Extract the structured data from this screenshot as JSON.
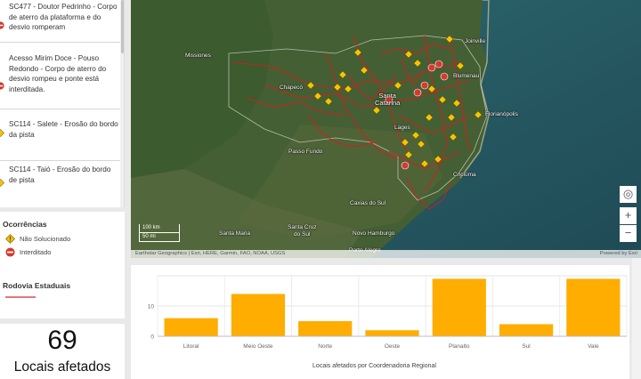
{
  "list": {
    "items": [
      {
        "text": "SC477 - Doutor Pedrinho - Corpo de aterro da plataforma e do desvio romperam",
        "status": "interditado"
      },
      {
        "text": "Acesso Mirim Doce - Pouso Redondo - Corpo de aterro do desvio rompeu e ponte está interditada.",
        "status": "interditado"
      },
      {
        "text": "SC114 - Salete - Erosão do bordo da pista",
        "status": "nao_solucionado"
      },
      {
        "text": "SC114 - Taió - Erosão do bordo de pista",
        "status": "nao_solucionado"
      }
    ]
  },
  "legend": {
    "title": "Ocorrências",
    "items": [
      {
        "label": "Não Solucionado",
        "icon": "warning-diamond-icon",
        "color": "#f5c400"
      },
      {
        "label": "Interditado",
        "icon": "no-entry-icon",
        "color": "#d63a2f"
      }
    ],
    "roads_title": "Rodovia Estaduais",
    "roads_color": "#e0787a"
  },
  "summary": {
    "value": "69",
    "label": "Locais afetados"
  },
  "map": {
    "places": [
      {
        "name": "Missiones",
        "big": false
      },
      {
        "name": "Joinville",
        "big": false
      },
      {
        "name": "Blumenau",
        "big": false
      },
      {
        "name": "Chapecó",
        "big": false
      },
      {
        "name": "Santa\nCatarina",
        "big": true
      },
      {
        "name": "Florianópolis",
        "big": false
      },
      {
        "name": "Lages",
        "big": false
      },
      {
        "name": "Passo Fundo",
        "big": false
      },
      {
        "name": "Criciúma",
        "big": false
      },
      {
        "name": "Caxias do Sul",
        "big": false
      },
      {
        "name": "Santa Maria",
        "big": false
      },
      {
        "name": "Santa Cruz\ndo Sul",
        "big": false
      },
      {
        "name": "Novo Hamburgo",
        "big": false
      },
      {
        "name": "Porto Alegre",
        "big": false
      }
    ],
    "scale_km": "100 km",
    "scale_mi": "50 mi",
    "attribution": "Earthstar Geographics | Esri, HERE, Garmin, FAO, NOAA, USGS",
    "powered_by": "Powered by Esri",
    "buttons": [
      {
        "name": "locate-button",
        "icon": "crosshair-icon",
        "glyph": "◎"
      },
      {
        "name": "zoom-in-button",
        "icon": "plus-icon",
        "glyph": "+"
      },
      {
        "name": "zoom-out-button",
        "icon": "minus-icon",
        "glyph": "−"
      }
    ]
  },
  "chart_data": {
    "type": "bar",
    "categories": [
      "Litoral",
      "Meio Oeste",
      "Norte",
      "Oeste",
      "Planalto",
      "Sul",
      "Vale"
    ],
    "values": [
      6,
      14,
      5,
      2,
      19,
      4,
      19
    ],
    "xlabel": "Locais afetados por Coordenadoria Regional",
    "ylabel": "",
    "ylim": [
      0,
      20
    ],
    "yticks": [
      0,
      10
    ],
    "bar_color": "#ffad00",
    "grid": true
  }
}
